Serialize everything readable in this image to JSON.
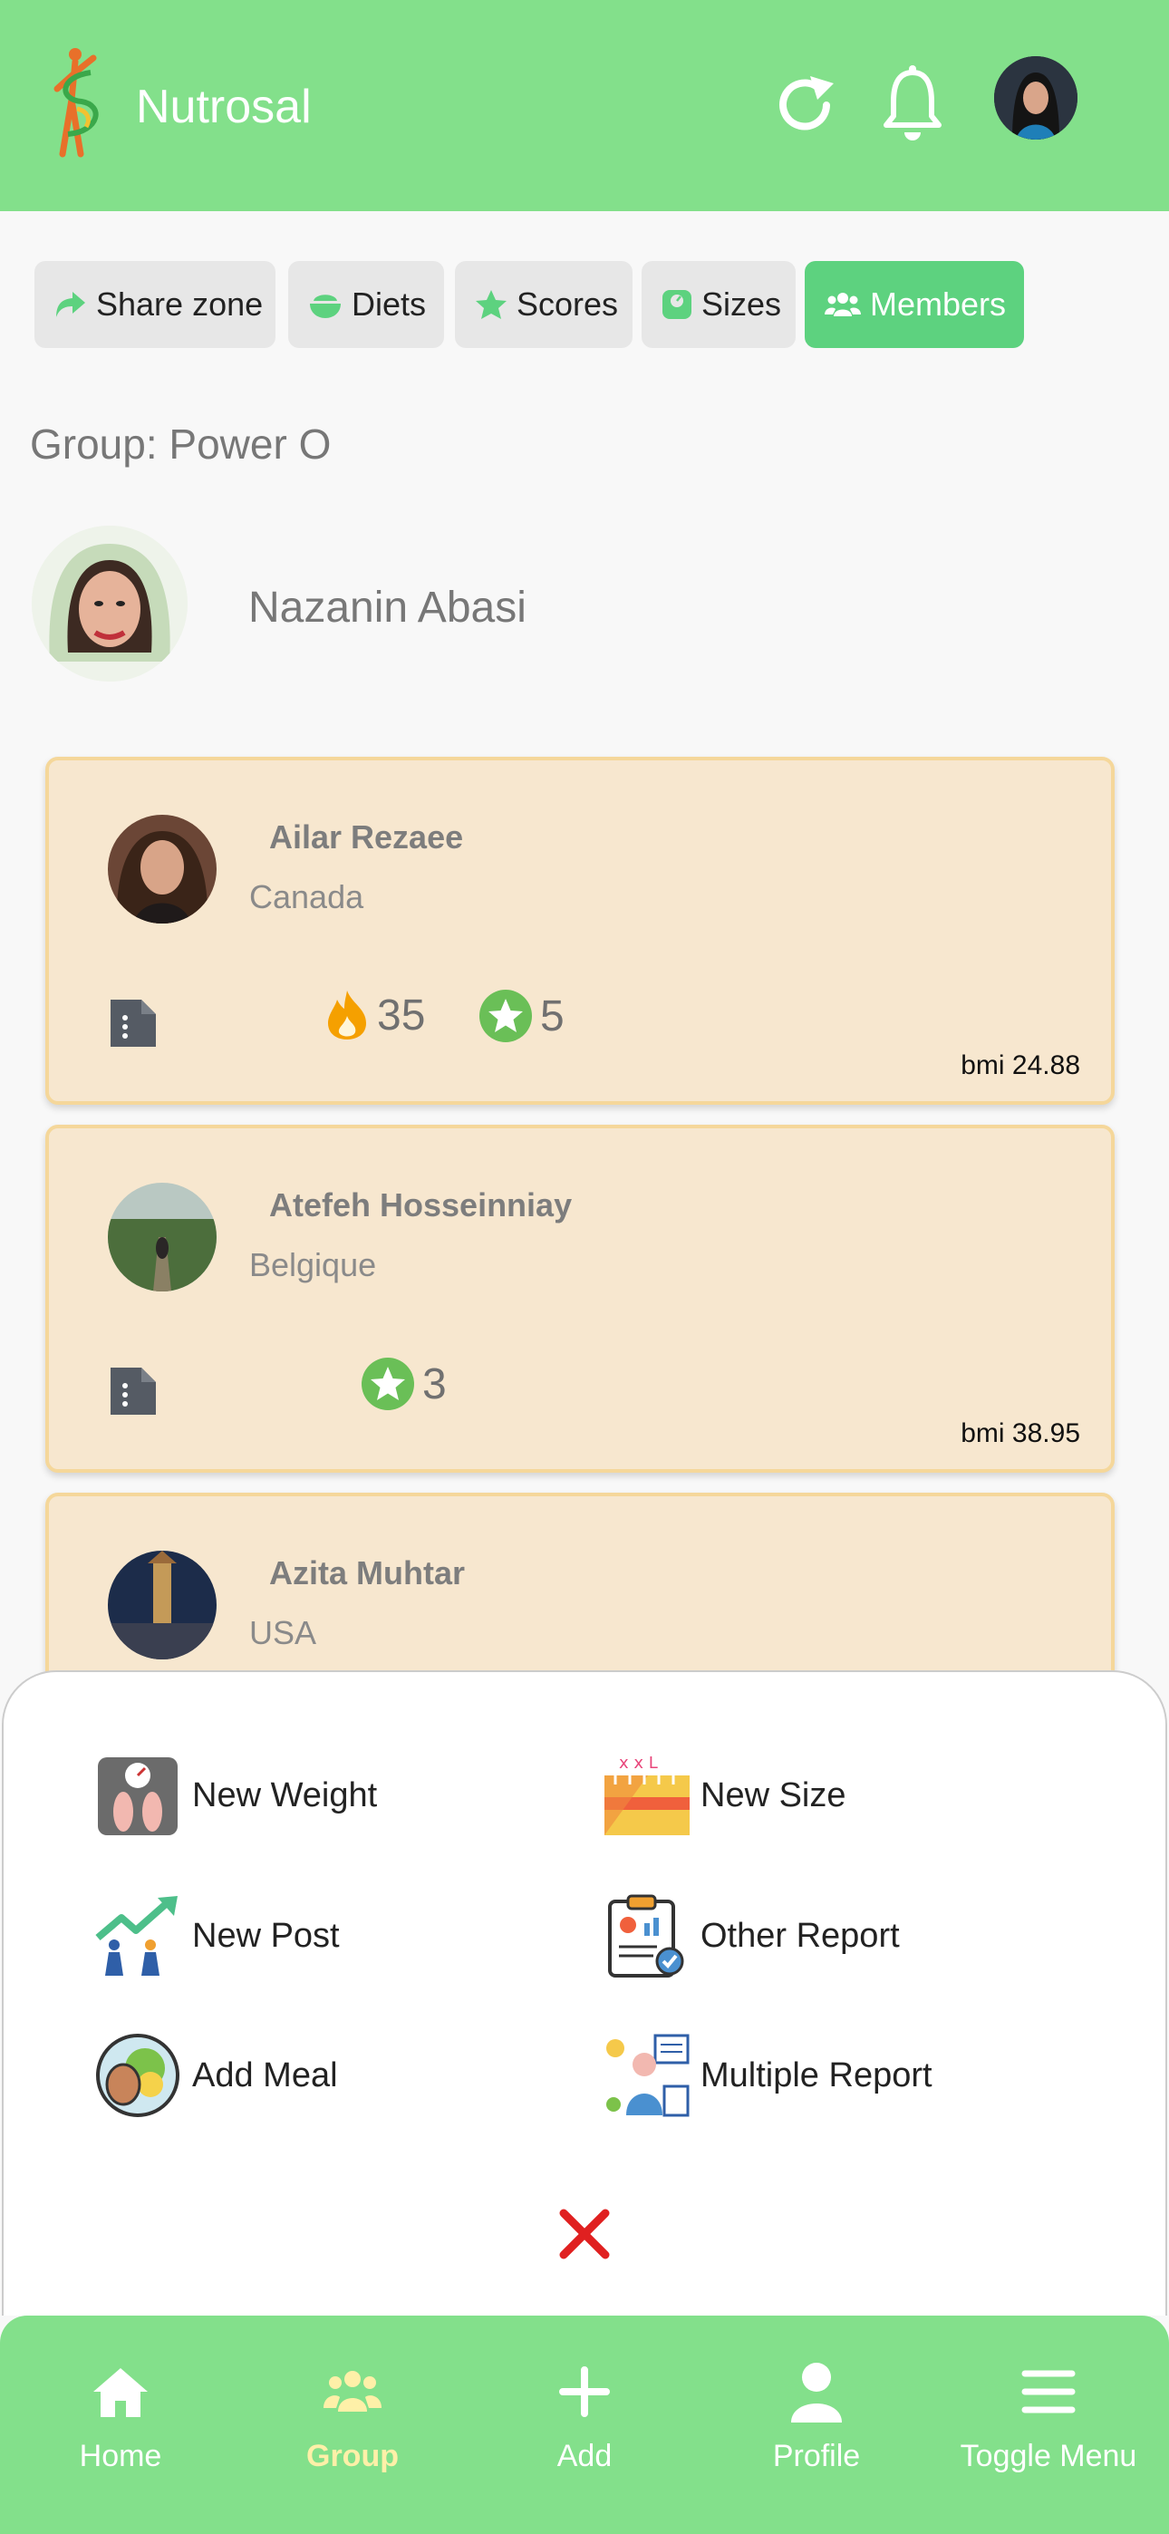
{
  "app": {
    "name": "Nutrosal"
  },
  "tabs": [
    {
      "label": "Share zone",
      "icon": "share-icon"
    },
    {
      "label": "Diets",
      "icon": "bowl-icon"
    },
    {
      "label": "Scores",
      "icon": "star-icon"
    },
    {
      "label": "Sizes",
      "icon": "scale-icon"
    },
    {
      "label": "Members",
      "icon": "users-icon",
      "active": true
    }
  ],
  "group": {
    "title": "Group: Power O",
    "leader": "Nazanin Abasi"
  },
  "members": [
    {
      "name": "Ailar Rezaee",
      "country": "Canada",
      "streak": "35",
      "score": "5",
      "bmi": "bmi 24.88"
    },
    {
      "name": "Atefeh Hosseinniay",
      "country": "Belgique",
      "score": "3",
      "bmi": "bmi 38.95"
    },
    {
      "name": "Azita Muhtar",
      "country": "USA"
    }
  ],
  "actions": [
    {
      "label": "New Weight",
      "icon": "scale-weight-icon"
    },
    {
      "label": "New Size",
      "icon": "tape-measure-icon"
    },
    {
      "label": "New Post",
      "icon": "growth-post-icon"
    },
    {
      "label": "Other Report",
      "icon": "report-clipboard-icon"
    },
    {
      "label": "Add Meal",
      "icon": "meal-plate-icon"
    },
    {
      "label": "Multiple Report",
      "icon": "multi-report-icon"
    }
  ],
  "nav": [
    {
      "label": "Home",
      "icon": "home-icon"
    },
    {
      "label": "Group",
      "icon": "group-icon",
      "active": true
    },
    {
      "label": "Add",
      "icon": "plus-icon"
    },
    {
      "label": "Profile",
      "icon": "user-icon"
    },
    {
      "label": "Toggle Menu",
      "icon": "hamburger-icon"
    }
  ],
  "colors": {
    "header": "#83e08b",
    "active_tab": "#5dd27f",
    "card": "#f7e7cf",
    "card_border": "#f5d79a",
    "close": "#e02020",
    "nav_active": "#fef0a8"
  }
}
